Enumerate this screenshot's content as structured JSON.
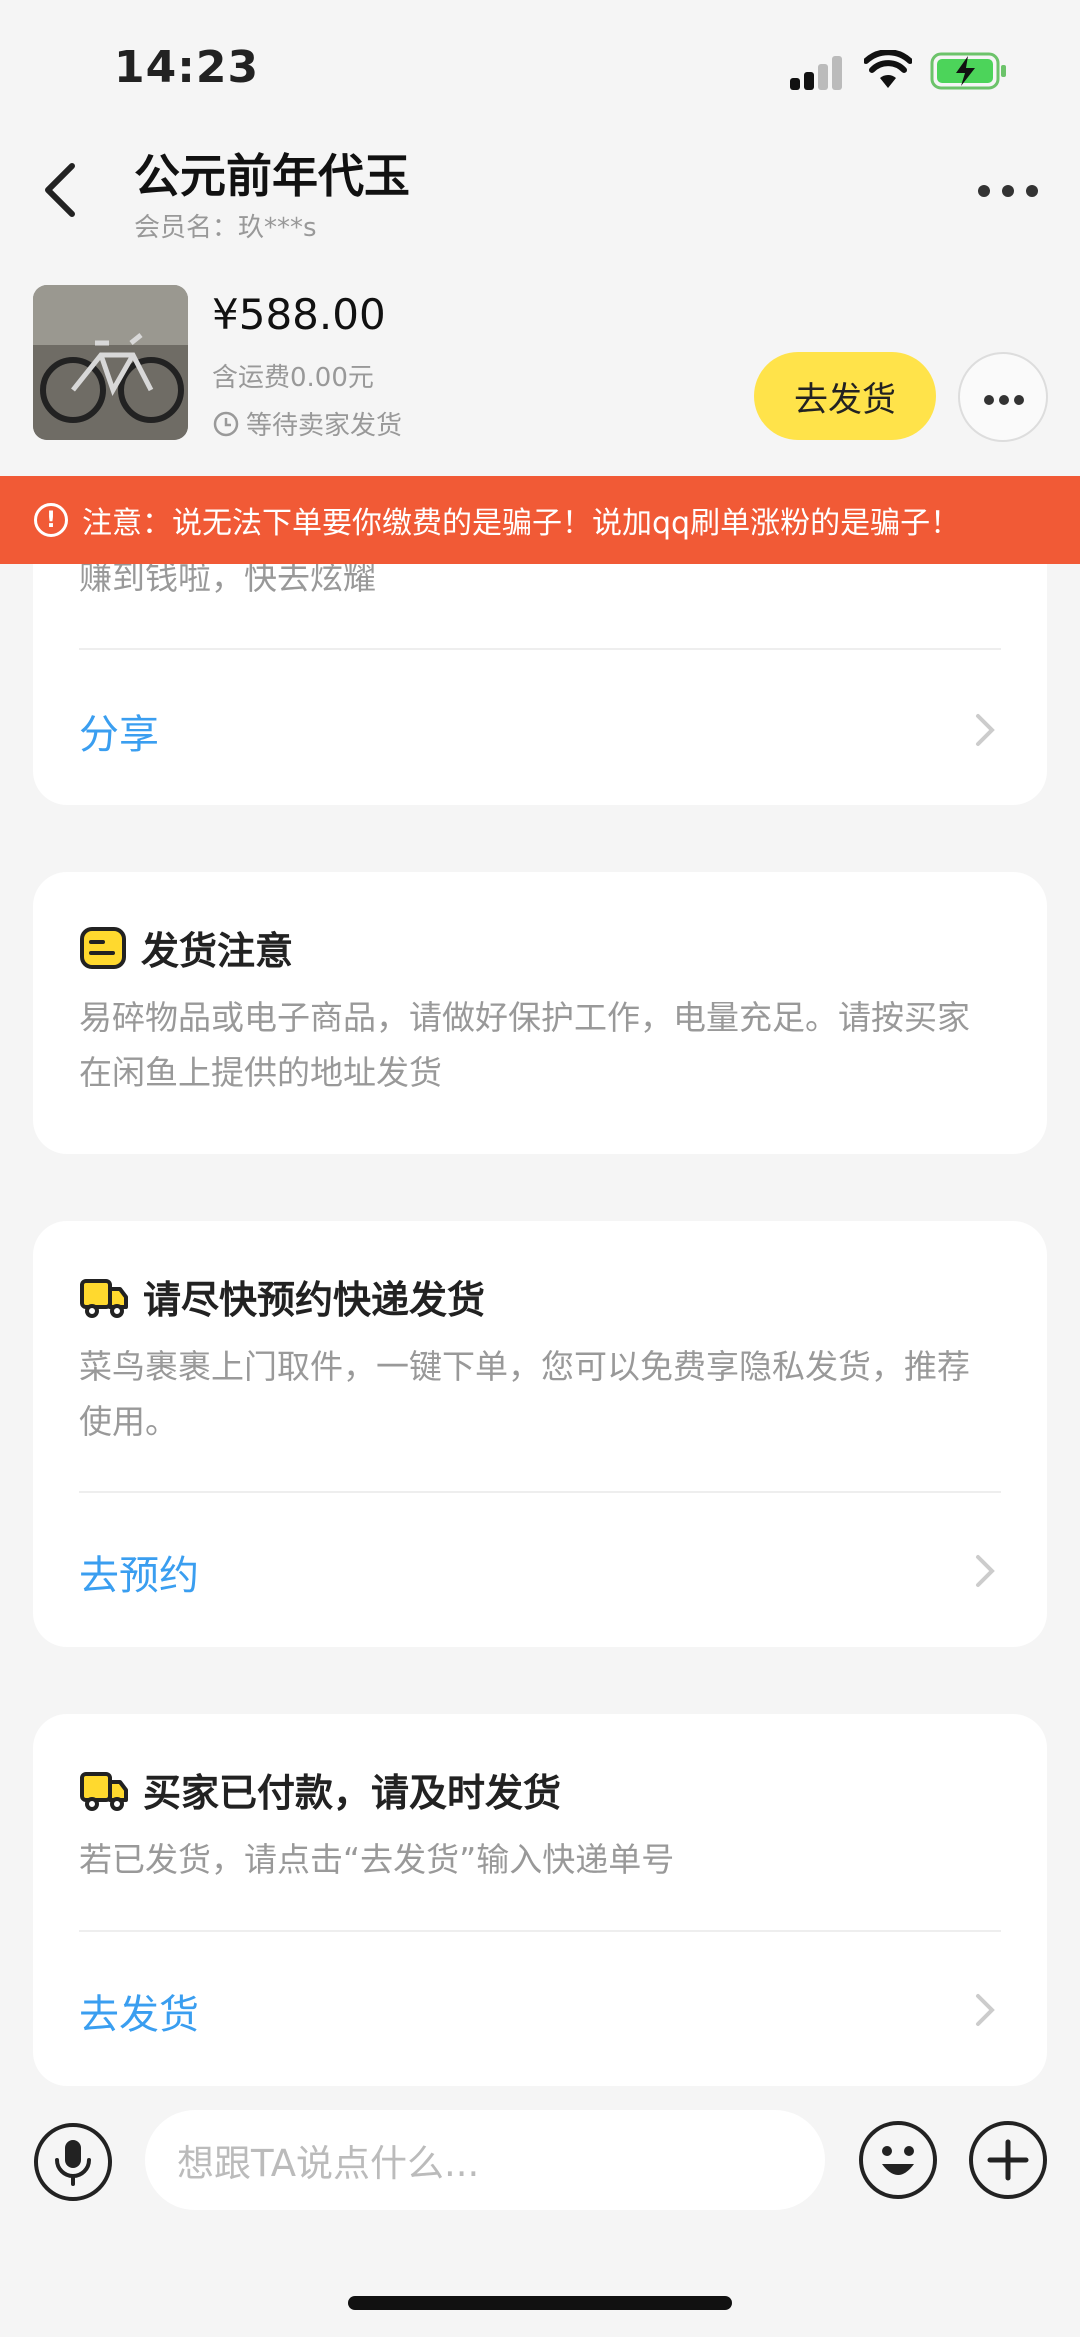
{
  "status_bar": {
    "time": "14:23"
  },
  "header": {
    "title": "公元前年代玉",
    "subtitle": "会员名：玖***s"
  },
  "order": {
    "price": "¥588.00",
    "shipping": "含运费0.00元",
    "status": "等待卖家发货",
    "ship_button": "去发货"
  },
  "warning": {
    "text": "注意：说无法下单要你缴费的是骗子！说加qq刷单涨粉的是骗子！"
  },
  "cards": {
    "share_card": {
      "partial_text": "赚到钱啦，快去炫耀",
      "link": "分享"
    },
    "notice_card": {
      "title": "发货注意",
      "desc": "易碎物品或电子商品，请做好保护工作，电量充足。请按买家在闲鱼上提供的地址发货"
    },
    "express_card": {
      "title": "请尽快预约快递发货",
      "desc": "菜鸟裹裹上门取件，一键下单，您可以免费享隐私发货，推荐使用。",
      "link": "去预约"
    },
    "paid_card": {
      "title": "买家已付款，请及时发货",
      "desc": "若已发货，请点击“去发货”输入快递单号",
      "link": "去发货"
    }
  },
  "input_bar": {
    "placeholder": "想跟TA说点什么..."
  },
  "colors": {
    "accent_yellow": "#ffe34a",
    "warning_red": "#f15a36",
    "link_blue": "#3a9ef0"
  }
}
